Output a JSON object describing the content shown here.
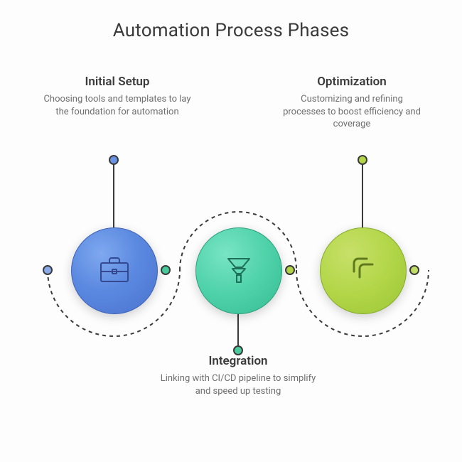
{
  "title": "Automation Process Phases",
  "phases": [
    {
      "heading": "Initial Setup",
      "description": "Choosing tools and templates to lay the foundation for automation",
      "icon": "briefcase-icon",
      "color": "#5b89e0"
    },
    {
      "heading": "Integration",
      "description": "Linking with CI/CD pipeline to simplify and speed up testing",
      "icon": "funnel-icon",
      "color": "#4fd2a9"
    },
    {
      "heading": "Optimization",
      "description": "Customizing and refining processes to boost efficiency and coverage",
      "icon": "arrows-icon",
      "color": "#b2d648"
    }
  ]
}
